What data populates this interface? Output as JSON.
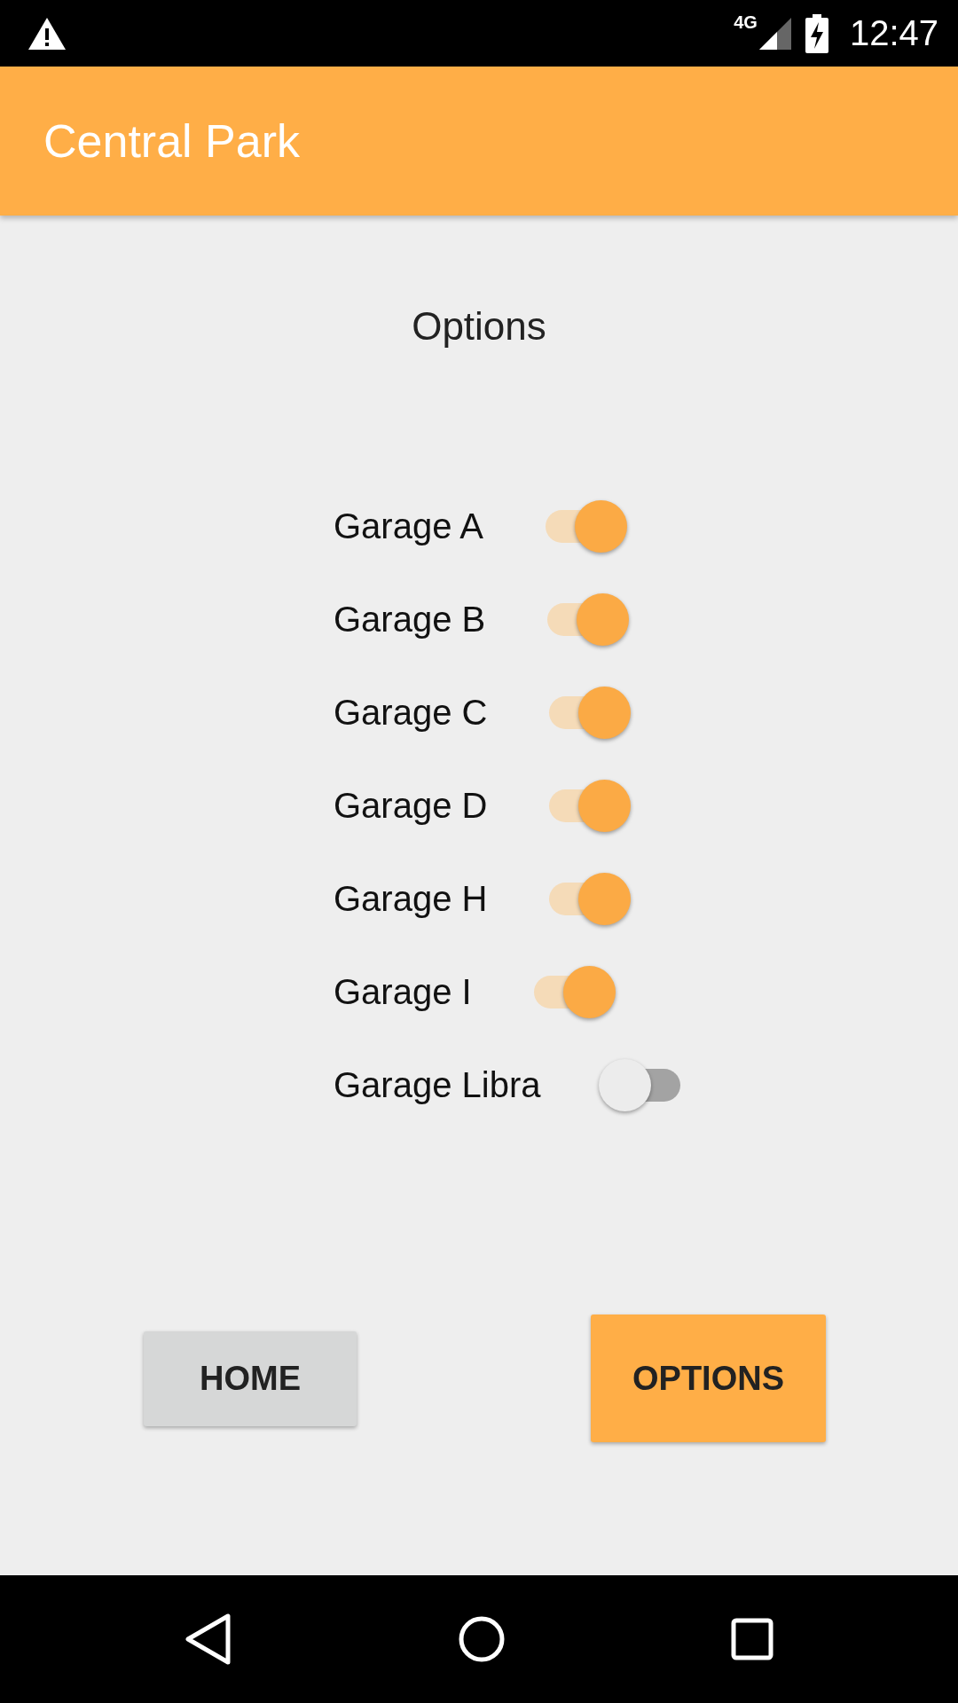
{
  "status_bar": {
    "network": "4G",
    "time": "12:47"
  },
  "app_bar": {
    "title": "Central Park"
  },
  "heading": "Options",
  "garages": [
    {
      "label": "Garage A",
      "on": true
    },
    {
      "label": "Garage B",
      "on": true
    },
    {
      "label": "Garage C",
      "on": true
    },
    {
      "label": "Garage D",
      "on": true
    },
    {
      "label": "Garage H",
      "on": true
    },
    {
      "label": "Garage I",
      "on": true
    },
    {
      "label": "Garage Libra",
      "on": false
    }
  ],
  "buttons": [
    {
      "label": "HOME",
      "selected": false
    },
    {
      "label": "OPTIONS",
      "selected": true
    }
  ]
}
